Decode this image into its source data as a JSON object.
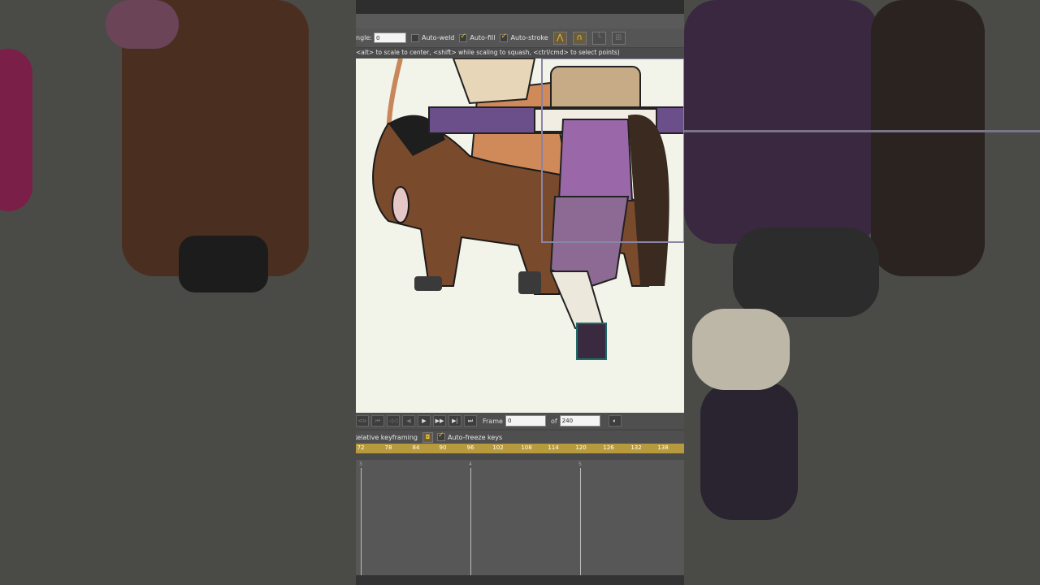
{
  "toolbar": {
    "angle_label": "ngle:",
    "angle_value": "0",
    "auto_weld": "Auto-weld",
    "auto_fill": "Auto-fill",
    "auto_stroke": "Auto-stroke"
  },
  "hint": "<alt> to scale to center, <shift> while scaling to squash, <ctrl/cmd> to select points)",
  "playback": {
    "frame_label": "Frame",
    "frame_value": "0",
    "of_label": "of",
    "total_value": "240"
  },
  "keyframing": {
    "relative_label": "Relative keyframing",
    "auto_freeze_label": "Auto-freeze keys"
  },
  "ruler_ticks": [
    "72",
    "78",
    "84",
    "90",
    "96",
    "102",
    "108",
    "114",
    "120",
    "126",
    "132",
    "138"
  ],
  "timeline_labels": [
    "3",
    "4",
    "5"
  ],
  "colors": {
    "ruler": "#b79a3e",
    "canvas": "#f3f4e9",
    "accent_check": "#e6c22a"
  }
}
